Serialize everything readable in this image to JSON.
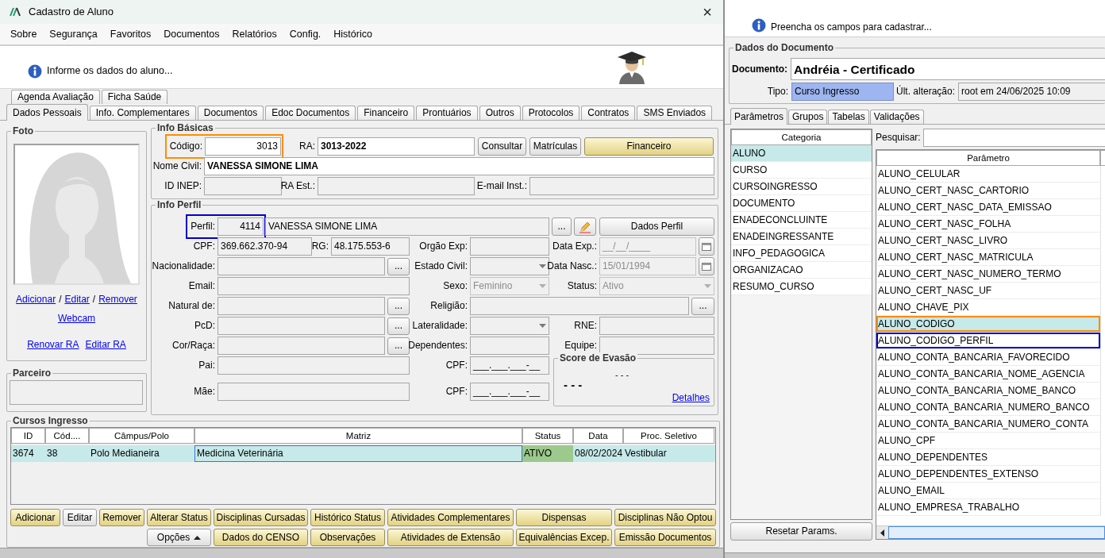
{
  "window": {
    "title": "Cadastro de Aluno",
    "close": "×"
  },
  "menu": [
    "Sobre",
    "Segurança",
    "Favoritos",
    "Documentos",
    "Relatórios",
    "Config.",
    "Histórico"
  ],
  "info_message": "Informe os dados do aluno...",
  "tabs_back": [
    {
      "label": "Agenda Avaliação",
      "selected": false
    },
    {
      "label": "Ficha Saúde",
      "selected": false
    }
  ],
  "tabs_front": [
    {
      "label": "Dados Pessoais",
      "selected": true
    },
    {
      "label": "Info. Complementares",
      "selected": false
    },
    {
      "label": "Documentos",
      "selected": false
    },
    {
      "label": "Edoc Documentos",
      "selected": false
    },
    {
      "label": "Financeiro",
      "selected": false
    },
    {
      "label": "Prontuários",
      "selected": false
    },
    {
      "label": "Outros",
      "selected": false
    },
    {
      "label": "Protocolos",
      "selected": false
    },
    {
      "label": "Contratos",
      "selected": false
    },
    {
      "label": "SMS Enviados",
      "selected": false
    }
  ],
  "photo": {
    "title": "Foto",
    "links": [
      {
        "kind": "link",
        "text": "Adicionar"
      },
      {
        "kind": "separator",
        "text": "/"
      },
      {
        "kind": "link",
        "text": "Editar"
      },
      {
        "kind": "separator",
        "text": "/"
      },
      {
        "kind": "link",
        "text": "Remover"
      }
    ],
    "webcam": "Webcam",
    "ra_links": [
      "Renovar RA",
      "Editar RA"
    ]
  },
  "partner": {
    "title": "Parceiro"
  },
  "info_basicas": {
    "title": "Info Básicas",
    "fields": [
      {
        "label": "Código:",
        "value": "3013",
        "kind": "number",
        "readonly": false,
        "disabled": false,
        "bold": false,
        "color": "#ff8c00"
      },
      {
        "label": "RA:",
        "value": "3013-2022",
        "kind": "text",
        "readonly": false,
        "disabled": false,
        "bold": true
      },
      {
        "label": "Nome Civil:",
        "value": "VANESSA SIMONE LIMA",
        "kind": "text",
        "readonly": false,
        "disabled": false,
        "bold": true
      },
      {
        "label": "ID INEP:",
        "kind": "text",
        "readonly": true,
        "disabled": false
      },
      {
        "label": "RA Est.:",
        "kind": "text",
        "readonly": true,
        "disabled": false
      },
      {
        "label": "E-mail Inst.:",
        "kind": "text",
        "readonly": true,
        "disabled": false
      }
    ],
    "buttons": [
      {
        "label": "Consultar",
        "kind": "default"
      },
      {
        "label": "Matrículas",
        "kind": "default"
      },
      {
        "label": "Financeiro",
        "kind": "accent"
      }
    ]
  },
  "info_perfil": {
    "title": "Info Perfil",
    "fields": [
      {
        "label": "Perfil:",
        "value": "4114",
        "kind": "number",
        "readonly": true,
        "disabled": false,
        "color": "#0000cc"
      },
      {
        "label": "CPF:",
        "value": "369.662.370-94",
        "kind": "text",
        "readonly": true,
        "disabled": false
      },
      {
        "label": "RG:",
        "value": "48.175.553-6",
        "kind": "text",
        "readonly": true,
        "disabled": false
      },
      {
        "label": "Orgão Exp:",
        "kind": "text",
        "readonly": true,
        "disabled": false
      },
      {
        "label": "Data Exp.:",
        "value": "__/__/____",
        "kind": "date",
        "readonly": true,
        "disabled": true
      },
      {
        "label": "Nacionalidade:",
        "kind": "lookup",
        "readonly": true,
        "disabled": false,
        "button": "..."
      },
      {
        "label": "Estado Civil:",
        "kind": "select",
        "readonly": true,
        "disabled": false
      },
      {
        "label": "Data Nasc.:",
        "value": "15/01/1994",
        "kind": "date",
        "readonly": true,
        "disabled": true
      },
      {
        "label": "Email:",
        "kind": "text",
        "readonly": true,
        "disabled": false
      },
      {
        "label": "Sexo:",
        "value": "Feminino",
        "kind": "select",
        "readonly": true,
        "disabled": true
      },
      {
        "label": "Status:",
        "value": "Ativo",
        "kind": "select",
        "readonly": true,
        "disabled": true
      },
      {
        "label": "Natural de:",
        "kind": "lookup",
        "readonly": true,
        "disabled": false,
        "button": "..."
      },
      {
        "label": "Religião:",
        "kind": "lookup",
        "readonly": true,
        "disabled": false,
        "button": "..."
      },
      {
        "label": "PcD:",
        "kind": "lookup",
        "readonly": true,
        "disabled": false,
        "button": "..."
      },
      {
        "label": "Lateralidade:",
        "kind": "select",
        "readonly": true,
        "disabled": false
      },
      {
        "label": "RNE:",
        "kind": "text",
        "readonly": true,
        "disabled": false
      },
      {
        "label": "Cor/Raça:",
        "kind": "lookup",
        "readonly": true,
        "disabled": false,
        "button": "..."
      },
      {
        "label": "Dependentes:",
        "kind": "text",
        "readonly": true,
        "disabled": false
      },
      {
        "label": "Equipe:",
        "kind": "text",
        "readonly": true,
        "disabled": false
      },
      {
        "label": "Pai:",
        "kind": "text",
        "readonly": true,
        "disabled": false
      },
      {
        "label": "CPF:",
        "value": "___.___.___-__",
        "kind": "text",
        "readonly": true,
        "disabled": false
      },
      {
        "label": "Mãe:",
        "kind": "text",
        "readonly": true,
        "disabled": false
      },
      {
        "label": "CPF:",
        "value": "___.___.___-__",
        "kind": "text",
        "readonly": true,
        "disabled": false
      }
    ],
    "profile_name": "VANESSA SIMONE LIMA",
    "profile_buttons": [
      {
        "label": "...",
        "kind": "browse"
      },
      {
        "kind": "edit"
      },
      {
        "label": "Dados Perfil",
        "kind": "default"
      }
    ],
    "score": {
      "title": "Score de Evasão",
      "value": "- - -",
      "trend": "- - -",
      "link": "Detalhes"
    }
  },
  "cursos": {
    "title": "Cursos Ingresso",
    "columns": [
      "ID",
      "Cód....",
      "Câmpus/Polo",
      "Matriz",
      "Status",
      "Data",
      "Proc. Seletivo"
    ],
    "rows": [
      {
        "selected": true,
        "cells": [
          {
            "text": "3674",
            "focused": false
          },
          {
            "text": "38",
            "focused": false
          },
          {
            "text": "Polo Medianeira",
            "focused": false
          },
          {
            "text": "Medicina Veterinária",
            "focused": true
          },
          {
            "text": "ATIVO",
            "focused": false,
            "color": "#9cc98c"
          },
          {
            "text": "08/02/2024",
            "focused": false
          },
          {
            "text": "Vestibular",
            "focused": false
          }
        ]
      }
    ],
    "button_rows": [
      [
        {
          "label": "Adicionar",
          "kind": "accent"
        },
        {
          "label": "Editar",
          "kind": "default"
        },
        {
          "label": "Remover",
          "kind": "accent"
        },
        {
          "label": "Alterar Status",
          "kind": "accent"
        },
        {
          "label": "Disciplinas Cursadas",
          "kind": "accent"
        },
        {
          "label": "Histórico Status",
          "kind": "accent"
        },
        {
          "label": "Atividades Complementares",
          "kind": "accent"
        },
        {
          "label": "Dispensas",
          "kind": "accent"
        },
        {
          "label": "Disciplinas Não Optou",
          "kind": "accent"
        }
      ],
      [
        {
          "label": "Opções",
          "kind": "menu"
        },
        {
          "label": "Dados do CENSO",
          "kind": "accent"
        },
        {
          "label": "Observações",
          "kind": "accent"
        },
        {
          "label": "Atividades de Extensão",
          "kind": "accent"
        },
        {
          "label": "Equivalências Excep.",
          "kind": "accent"
        },
        {
          "label": "Emissão Documentos",
          "kind": "accent"
        }
      ]
    ]
  },
  "doc_panel": {
    "info_message": "Preencha os campos para cadastrar...",
    "group_title": "Dados do Documento",
    "document_label": "Documento:",
    "document_value": "Andréia - Certificado",
    "type_label": "Tipo:",
    "type_value": "Curso Ingresso",
    "changed_label": "Últ. alteração:",
    "changed_value": "root em 24/06/2025 10:09"
  },
  "doc_tabs": [
    {
      "label": "Parâmetros",
      "selected": true
    },
    {
      "label": "Grupos",
      "selected": false
    },
    {
      "label": "Tabelas",
      "selected": false
    },
    {
      "label": "Validações",
      "selected": false
    }
  ],
  "categories": {
    "header": "Categoria",
    "items": [
      {
        "label": "ALUNO",
        "selected": true
      },
      {
        "label": "CURSO",
        "selected": false
      },
      {
        "label": "CURSOINGRESSO",
        "selected": false
      },
      {
        "label": "DOCUMENTO",
        "selected": false
      },
      {
        "label": "ENADECONCLUINTE",
        "selected": false
      },
      {
        "label": "ENADEINGRESSANTE",
        "selected": false
      },
      {
        "label": "INFO_PEDAGOGICA",
        "selected": false
      },
      {
        "label": "ORGANIZACAO",
        "selected": false
      },
      {
        "label": "RESUMO_CURSO",
        "selected": false
      }
    ]
  },
  "reset_button": "Resetar Params.",
  "search": {
    "label": "Pesquisar:"
  },
  "parameters": {
    "header": "Parâmetro",
    "rows": [
      {
        "label": "ALUNO_CELULAR",
        "selected": false
      },
      {
        "label": "ALUNO_CERT_NASC_CARTORIO",
        "selected": false
      },
      {
        "label": "ALUNO_CERT_NASC_DATA_EMISSAO",
        "selected": false
      },
      {
        "label": "ALUNO_CERT_NASC_FOLHA",
        "selected": false
      },
      {
        "label": "ALUNO_CERT_NASC_LIVRO",
        "selected": false
      },
      {
        "label": "ALUNO_CERT_NASC_MATRICULA",
        "selected": false
      },
      {
        "label": "ALUNO_CERT_NASC_NUMERO_TERMO",
        "selected": false
      },
      {
        "label": "ALUNO_CERT_NASC_UF",
        "selected": false
      },
      {
        "label": "ALUNO_CHAVE_PIX",
        "selected": false
      },
      {
        "label": "ALUNO_CODIGO",
        "selected": true,
        "color": "#ff8c00"
      },
      {
        "label": "ALUNO_CODIGO_PERFIL",
        "selected": false,
        "color": "#0000cc"
      },
      {
        "label": "ALUNO_CONTA_BANCARIA_FAVORECIDO",
        "selected": false
      },
      {
        "label": "ALUNO_CONTA_BANCARIA_NOME_AGENCIA",
        "selected": false
      },
      {
        "label": "ALUNO_CONTA_BANCARIA_NOME_BANCO",
        "selected": false
      },
      {
        "label": "ALUNO_CONTA_BANCARIA_NUMERO_BANCO",
        "selected": false
      },
      {
        "label": "ALUNO_CONTA_BANCARIA_NUMERO_CONTA",
        "selected": false
      },
      {
        "label": "ALUNO_CPF",
        "selected": false
      },
      {
        "label": "ALUNO_DEPENDENTES",
        "selected": false
      },
      {
        "label": "ALUNO_DEPENDENTES_EXTENSO",
        "selected": false
      },
      {
        "label": "ALUNO_EMAIL",
        "selected": false
      },
      {
        "label": "ALUNO_EMPRESA_TRABALHO",
        "selected": false
      }
    ]
  }
}
